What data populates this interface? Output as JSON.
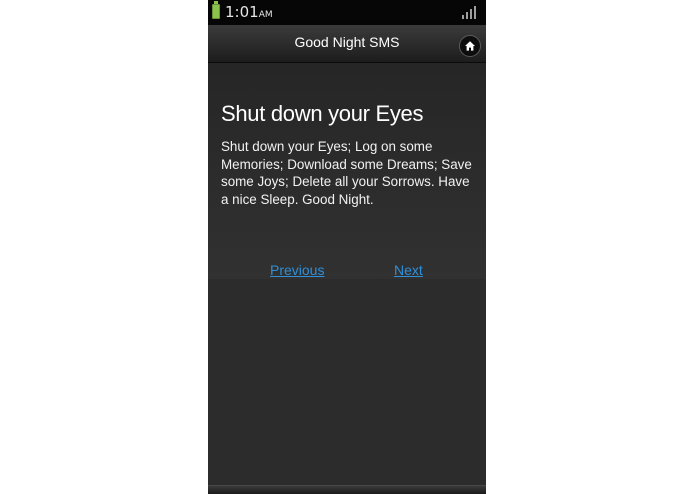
{
  "status_bar": {
    "time": "1:01",
    "ampm": "AM",
    "battery_icon": "battery-icon",
    "signal_icon": "signal-icon",
    "battery_color": "#8bc34a"
  },
  "header": {
    "title": "Good Night SMS",
    "home_icon": "home-icon"
  },
  "message": {
    "title": "Shut down your Eyes",
    "body": "Shut down your Eyes; Log on some Memories; Download some Dreams; Save some Joys; Delete all your Sorrows. Have a nice Sleep. Good Night."
  },
  "navigation": {
    "previous_label": "Previous",
    "next_label": "Next",
    "link_color": "#2f8fd8"
  }
}
